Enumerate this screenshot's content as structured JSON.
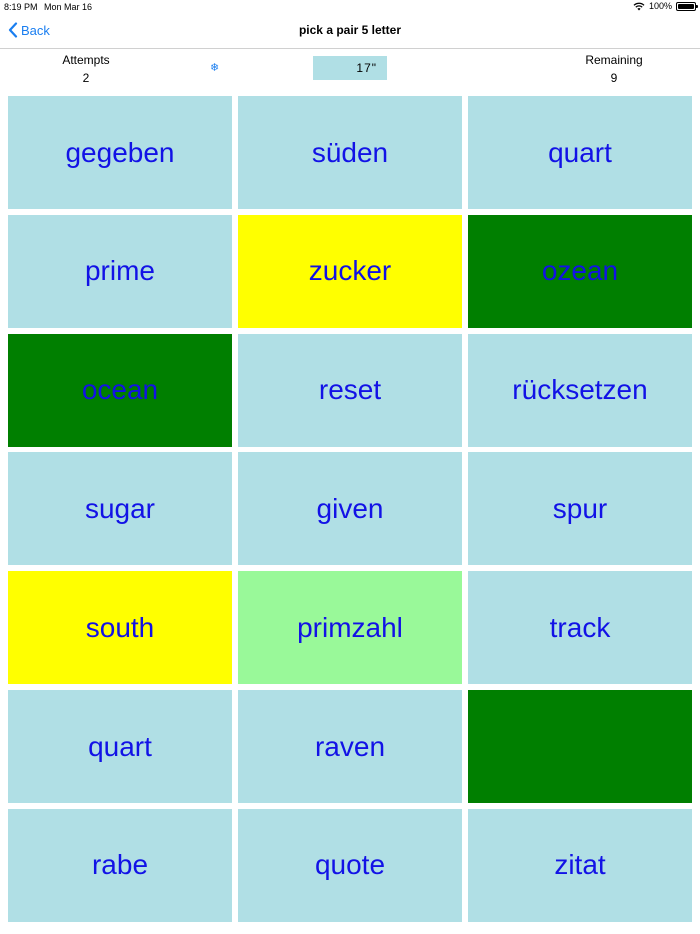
{
  "status_bar": {
    "time": "8:19 PM",
    "date": "Mon Mar 16",
    "battery": "100%",
    "battery_level": 1.0
  },
  "nav": {
    "back_label": "Back",
    "title": "pick a pair 5 letter"
  },
  "stats": {
    "attempts_label": "Attempts",
    "attempts_value": "2",
    "remaining_label": "Remaining",
    "remaining_value": "9",
    "timer": "17\""
  },
  "colors": {
    "default": "#b0dfe5",
    "selected": "#ffff00",
    "matched": "#007f00",
    "hint": "#99f999",
    "text": "#1212e6"
  },
  "tiles": [
    {
      "word": "gegeben",
      "state": "default"
    },
    {
      "word": "süden",
      "state": "default"
    },
    {
      "word": "quart",
      "state": "default"
    },
    {
      "word": "prime",
      "state": "default"
    },
    {
      "word": "zucker",
      "state": "selected"
    },
    {
      "word": "ozean",
      "state": "matched"
    },
    {
      "word": "ocean",
      "state": "matched"
    },
    {
      "word": "reset",
      "state": "default"
    },
    {
      "word": "rücksetzen",
      "state": "default"
    },
    {
      "word": "sugar",
      "state": "default"
    },
    {
      "word": "given",
      "state": "default"
    },
    {
      "word": "spur",
      "state": "default"
    },
    {
      "word": "south",
      "state": "selected"
    },
    {
      "word": "primzahl",
      "state": "hint"
    },
    {
      "word": "track",
      "state": "default"
    },
    {
      "word": "quart",
      "state": "default"
    },
    {
      "word": "raven",
      "state": "default"
    },
    {
      "word": "",
      "state": "matched"
    },
    {
      "word": "rabe",
      "state": "default"
    },
    {
      "word": "quote",
      "state": "default"
    },
    {
      "word": "zitat",
      "state": "default"
    }
  ]
}
